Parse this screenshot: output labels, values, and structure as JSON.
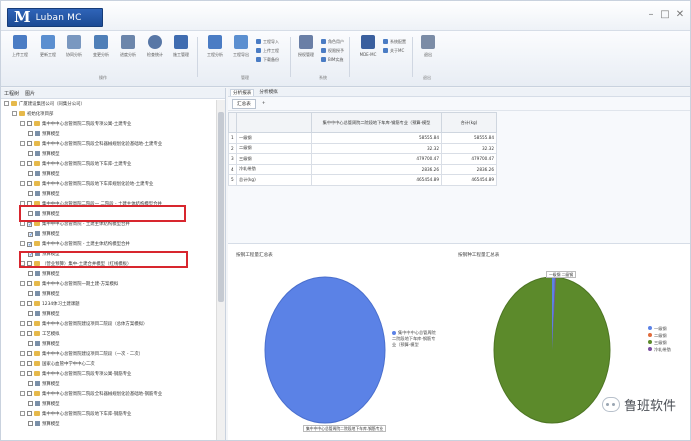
{
  "app": {
    "logo_letter": "M",
    "title": "Luban MC"
  },
  "window_controls": {
    "minimize": "–",
    "restore": "□",
    "close": "✕"
  },
  "ribbon": {
    "buttons": [
      {
        "label": "上传工程",
        "color": "#4a7cc4"
      },
      {
        "label": "更新工程",
        "color": "#5b8fd0"
      },
      {
        "label": "协同分析",
        "color": "#7a98c0"
      },
      {
        "label": "变更分析",
        "color": "#4f7fb8"
      },
      {
        "label": "进度分析",
        "color": "#6c86ab"
      },
      {
        "label": "检查统计",
        "color": "#5877a6"
      },
      {
        "label": "施工管理",
        "color": "#3f6cb0"
      },
      {
        "label": "工程分析",
        "color": "#4a7cc4"
      },
      {
        "label": "工程导出",
        "color": "#5b8fd0"
      },
      {
        "label": "授权管理",
        "color": "#6a7fa6"
      },
      {
        "label": "MDE-MC",
        "color": "#3a5f9e"
      },
      {
        "label": "退出",
        "color": "#7b8ca6"
      }
    ],
    "small_items": [
      "工程导入",
      "上传工程",
      "下载备份",
      "角色用户",
      "权限授予",
      "BIM实施",
      "系统配置",
      "关于MC"
    ],
    "groups": [
      "操作",
      "管理",
      "系统",
      "退出"
    ]
  },
  "left_panel": {
    "tabs": [
      "工程树",
      "图片"
    ],
    "tree": [
      {
        "label": "广厦建设集团公司（同集分公司）",
        "indent": 0,
        "checkbox": false
      },
      {
        "label": "初始化项目部",
        "indent": 1,
        "checkbox": false
      },
      {
        "label": "集中中中心总管周院二院段专项公寓-土建专业",
        "indent": 2,
        "checkbox": true
      },
      {
        "label": "预算模型",
        "indent": 3,
        "checkbox": true
      },
      {
        "label": "集中中中心总管周院二院段全科器械规划化验基础地-土建专业",
        "indent": 2,
        "checkbox": true
      },
      {
        "label": "预算模型",
        "indent": 3,
        "checkbox": true
      },
      {
        "label": "集中中中心总管周院二院段地下车库-土建专业",
        "indent": 2,
        "checkbox": true
      },
      {
        "label": "预算模型",
        "indent": 3,
        "checkbox": true
      },
      {
        "label": "集中中中心总管周院二院段地下车库规划化验地-土建专业",
        "indent": 2,
        "checkbox": true
      },
      {
        "label": "预算模型",
        "indent": 3,
        "checkbox": true
      },
      {
        "label": "集中中中心总管周院二院段一 二院段 - 土建主体结构模型合并",
        "indent": 2,
        "checkbox": true
      },
      {
        "label": "预算模型",
        "indent": 3,
        "checkbox": true
      },
      {
        "label": "集中中中心总管周院 - 土建主体结构模型合并",
        "indent": 2,
        "checkbox": true,
        "checked": true
      },
      {
        "label": "预算模型",
        "indent": 3,
        "checkbox": true,
        "checked": true
      },
      {
        "label": "集中中中心总管周院 - 土建主体结构模型合并",
        "indent": 2,
        "checkbox": true,
        "checked": true
      },
      {
        "label": "预算模型",
        "indent": 3,
        "checkbox": true,
        "checked": true
      },
      {
        "label": "（营业预算）集中-土建合并模型（红线模板）",
        "indent": 2,
        "checkbox": true
      },
      {
        "label": "预算模型",
        "indent": 3,
        "checkbox": true
      },
      {
        "label": "集中中中心总管周院一期土建-方案模拟",
        "indent": 2,
        "checkbox": true
      },
      {
        "label": "预算模型",
        "indent": 3,
        "checkbox": true
      },
      {
        "label": "1234体习土建课题",
        "indent": 2,
        "checkbox": true
      },
      {
        "label": "预算模型",
        "indent": 3,
        "checkbox": true
      },
      {
        "label": "集中中中心总管周院建设项目二院段（总体方案模拟）",
        "indent": 2,
        "checkbox": true
      },
      {
        "label": "工艺模拟",
        "indent": 2,
        "checkbox": true
      },
      {
        "label": "预算模型",
        "indent": 3,
        "checkbox": true
      },
      {
        "label": "集中中中心总管周院建设项目二院段（一次 - 二次）",
        "indent": 2,
        "checkbox": true
      },
      {
        "label": "国家心血管中学中中心二次",
        "indent": 2,
        "checkbox": true
      },
      {
        "label": "集中中中心总管周院二院段专项公寓-钢筋专业",
        "indent": 2,
        "checkbox": true
      },
      {
        "label": "预算模型",
        "indent": 3,
        "checkbox": true
      },
      {
        "label": "集中中中心总管周院二院段全科器械规划化验基础地-钢筋专业",
        "indent": 2,
        "checkbox": true
      },
      {
        "label": "预算模型",
        "indent": 3,
        "checkbox": true
      },
      {
        "label": "集中中中心总管周院二院段地下车库-钢筋专业",
        "indent": 2,
        "checkbox": true
      },
      {
        "label": "预算模型",
        "indent": 3,
        "checkbox": true
      }
    ]
  },
  "right_panel": {
    "tabs": [
      "分析报表",
      "分析模拟"
    ],
    "subtabs": [
      "汇总表"
    ],
    "add_symbol": "+",
    "table": {
      "columns": [
        "",
        "",
        "集中中中心总管周院二院段地下车库-钢筋专业（预算-模型",
        "合计(kg)"
      ],
      "rows": [
        [
          "1",
          "一级钢",
          "58555.84",
          "58555.84"
        ],
        [
          "2",
          "二级钢",
          "32.32",
          "32.32"
        ],
        [
          "3",
          "三级钢",
          "479700.47",
          "479700.47"
        ],
        [
          "4",
          "冷轧带肋",
          "2836.26",
          "2836.26"
        ],
        [
          "5",
          "总计(kg)",
          "465454.89",
          "465454.89"
        ]
      ]
    },
    "charts": [
      {
        "title": "按钢工程量汇总表",
        "legend": [
          {
            "name": "集中中中心总管周院二院段地下车库-钢筋专业（预算-模型",
            "color": "#5b82e6"
          }
        ],
        "pie_label": "集中中中心总管周院二院段地下车库-钢筋专业"
      },
      {
        "title": "按钢种工程量汇总表",
        "legend": [
          {
            "name": "一级钢",
            "color": "#5b82e6"
          },
          {
            "name": "二级钢",
            "color": "#e06b3c"
          },
          {
            "name": "三级钢",
            "color": "#5c8a2b"
          },
          {
            "name": "冷轧带肋",
            "color": "#7b4fa0"
          }
        ],
        "pie_label": "一级钢 二级钢"
      }
    ]
  },
  "watermark": {
    "text": "鲁班软件"
  }
}
